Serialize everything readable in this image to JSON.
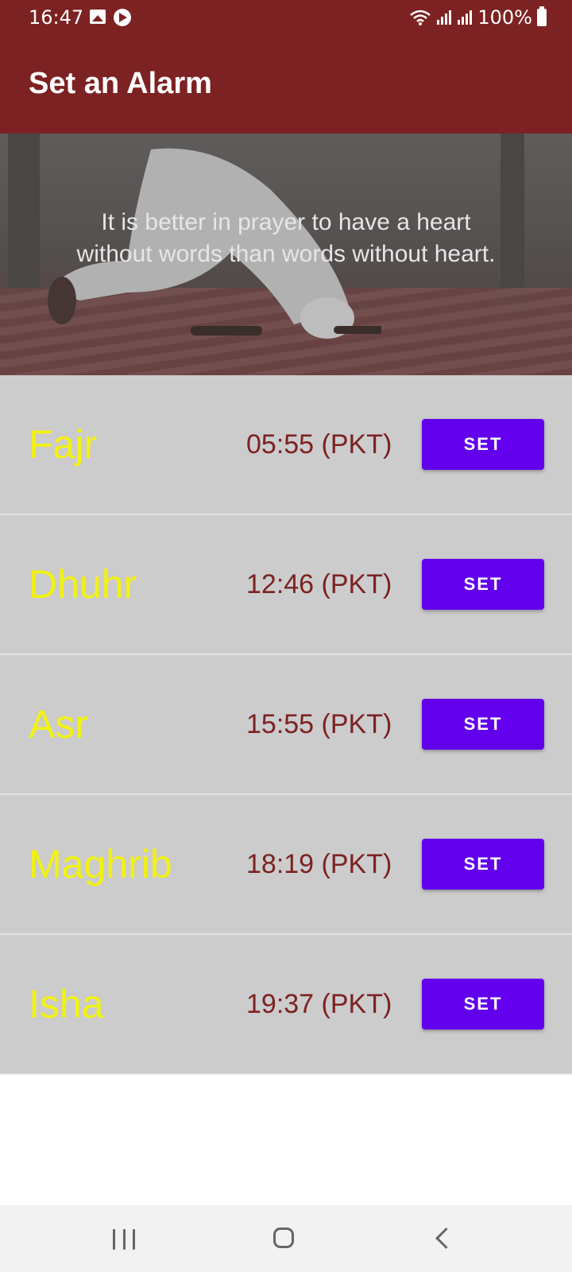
{
  "status_bar": {
    "time": "16:47",
    "battery": "100%",
    "icons": [
      "gallery-icon",
      "app-icon",
      "wifi-icon",
      "signal-icon",
      "signal-icon",
      "battery-icon"
    ]
  },
  "app_bar": {
    "title": "Set an Alarm",
    "color": "#7d2222"
  },
  "banner": {
    "quote": "It is better in prayer to have a heart without words than words without heart."
  },
  "prayers": [
    {
      "name": "Fajr",
      "time": "05:55 (PKT)",
      "button_label": "SET"
    },
    {
      "name": "Dhuhr",
      "time": "12:46 (PKT)",
      "button_label": "SET"
    },
    {
      "name": "Asr",
      "time": "15:55 (PKT)",
      "button_label": "SET"
    },
    {
      "name": "Maghrib",
      "time": "18:19 (PKT)",
      "button_label": "SET"
    },
    {
      "name": "Isha",
      "time": "19:37 (PKT)",
      "button_label": "SET"
    }
  ],
  "colors": {
    "prayer_name": "#f2f213",
    "prayer_time": "#7d2222",
    "button": "#6200ee",
    "row_background": "#cccccc"
  },
  "nav_bar": {
    "icons": [
      "recents-icon",
      "home-icon",
      "back-icon"
    ]
  }
}
